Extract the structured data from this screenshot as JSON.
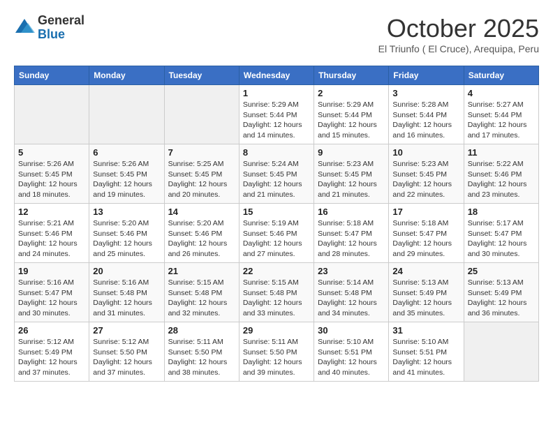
{
  "header": {
    "logo_general": "General",
    "logo_blue": "Blue",
    "month_title": "October 2025",
    "location": "El Triunfo ( El Cruce), Arequipa, Peru"
  },
  "days_of_week": [
    "Sunday",
    "Monday",
    "Tuesday",
    "Wednesday",
    "Thursday",
    "Friday",
    "Saturday"
  ],
  "weeks": [
    [
      {
        "day": "",
        "info": ""
      },
      {
        "day": "",
        "info": ""
      },
      {
        "day": "",
        "info": ""
      },
      {
        "day": "1",
        "info": "Sunrise: 5:29 AM\nSunset: 5:44 PM\nDaylight: 12 hours and 14 minutes."
      },
      {
        "day": "2",
        "info": "Sunrise: 5:29 AM\nSunset: 5:44 PM\nDaylight: 12 hours and 15 minutes."
      },
      {
        "day": "3",
        "info": "Sunrise: 5:28 AM\nSunset: 5:44 PM\nDaylight: 12 hours and 16 minutes."
      },
      {
        "day": "4",
        "info": "Sunrise: 5:27 AM\nSunset: 5:44 PM\nDaylight: 12 hours and 17 minutes."
      }
    ],
    [
      {
        "day": "5",
        "info": "Sunrise: 5:26 AM\nSunset: 5:45 PM\nDaylight: 12 hours and 18 minutes."
      },
      {
        "day": "6",
        "info": "Sunrise: 5:26 AM\nSunset: 5:45 PM\nDaylight: 12 hours and 19 minutes."
      },
      {
        "day": "7",
        "info": "Sunrise: 5:25 AM\nSunset: 5:45 PM\nDaylight: 12 hours and 20 minutes."
      },
      {
        "day": "8",
        "info": "Sunrise: 5:24 AM\nSunset: 5:45 PM\nDaylight: 12 hours and 21 minutes."
      },
      {
        "day": "9",
        "info": "Sunrise: 5:23 AM\nSunset: 5:45 PM\nDaylight: 12 hours and 21 minutes."
      },
      {
        "day": "10",
        "info": "Sunrise: 5:23 AM\nSunset: 5:45 PM\nDaylight: 12 hours and 22 minutes."
      },
      {
        "day": "11",
        "info": "Sunrise: 5:22 AM\nSunset: 5:46 PM\nDaylight: 12 hours and 23 minutes."
      }
    ],
    [
      {
        "day": "12",
        "info": "Sunrise: 5:21 AM\nSunset: 5:46 PM\nDaylight: 12 hours and 24 minutes."
      },
      {
        "day": "13",
        "info": "Sunrise: 5:20 AM\nSunset: 5:46 PM\nDaylight: 12 hours and 25 minutes."
      },
      {
        "day": "14",
        "info": "Sunrise: 5:20 AM\nSunset: 5:46 PM\nDaylight: 12 hours and 26 minutes."
      },
      {
        "day": "15",
        "info": "Sunrise: 5:19 AM\nSunset: 5:46 PM\nDaylight: 12 hours and 27 minutes."
      },
      {
        "day": "16",
        "info": "Sunrise: 5:18 AM\nSunset: 5:47 PM\nDaylight: 12 hours and 28 minutes."
      },
      {
        "day": "17",
        "info": "Sunrise: 5:18 AM\nSunset: 5:47 PM\nDaylight: 12 hours and 29 minutes."
      },
      {
        "day": "18",
        "info": "Sunrise: 5:17 AM\nSunset: 5:47 PM\nDaylight: 12 hours and 30 minutes."
      }
    ],
    [
      {
        "day": "19",
        "info": "Sunrise: 5:16 AM\nSunset: 5:47 PM\nDaylight: 12 hours and 30 minutes."
      },
      {
        "day": "20",
        "info": "Sunrise: 5:16 AM\nSunset: 5:48 PM\nDaylight: 12 hours and 31 minutes."
      },
      {
        "day": "21",
        "info": "Sunrise: 5:15 AM\nSunset: 5:48 PM\nDaylight: 12 hours and 32 minutes."
      },
      {
        "day": "22",
        "info": "Sunrise: 5:15 AM\nSunset: 5:48 PM\nDaylight: 12 hours and 33 minutes."
      },
      {
        "day": "23",
        "info": "Sunrise: 5:14 AM\nSunset: 5:48 PM\nDaylight: 12 hours and 34 minutes."
      },
      {
        "day": "24",
        "info": "Sunrise: 5:13 AM\nSunset: 5:49 PM\nDaylight: 12 hours and 35 minutes."
      },
      {
        "day": "25",
        "info": "Sunrise: 5:13 AM\nSunset: 5:49 PM\nDaylight: 12 hours and 36 minutes."
      }
    ],
    [
      {
        "day": "26",
        "info": "Sunrise: 5:12 AM\nSunset: 5:49 PM\nDaylight: 12 hours and 37 minutes."
      },
      {
        "day": "27",
        "info": "Sunrise: 5:12 AM\nSunset: 5:50 PM\nDaylight: 12 hours and 37 minutes."
      },
      {
        "day": "28",
        "info": "Sunrise: 5:11 AM\nSunset: 5:50 PM\nDaylight: 12 hours and 38 minutes."
      },
      {
        "day": "29",
        "info": "Sunrise: 5:11 AM\nSunset: 5:50 PM\nDaylight: 12 hours and 39 minutes."
      },
      {
        "day": "30",
        "info": "Sunrise: 5:10 AM\nSunset: 5:51 PM\nDaylight: 12 hours and 40 minutes."
      },
      {
        "day": "31",
        "info": "Sunrise: 5:10 AM\nSunset: 5:51 PM\nDaylight: 12 hours and 41 minutes."
      },
      {
        "day": "",
        "info": ""
      }
    ]
  ]
}
